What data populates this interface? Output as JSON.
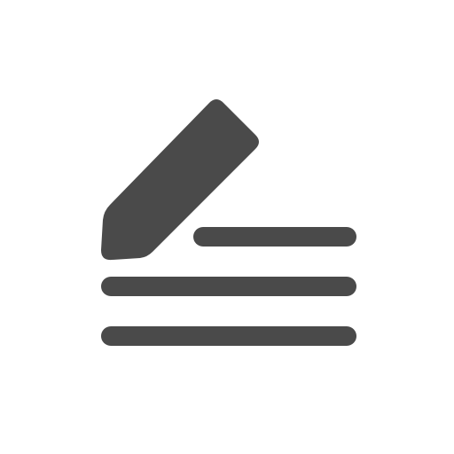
{
  "icon": {
    "name": "edit-notes-icon",
    "color": "#4a4a4a",
    "background": "#ffffff"
  }
}
